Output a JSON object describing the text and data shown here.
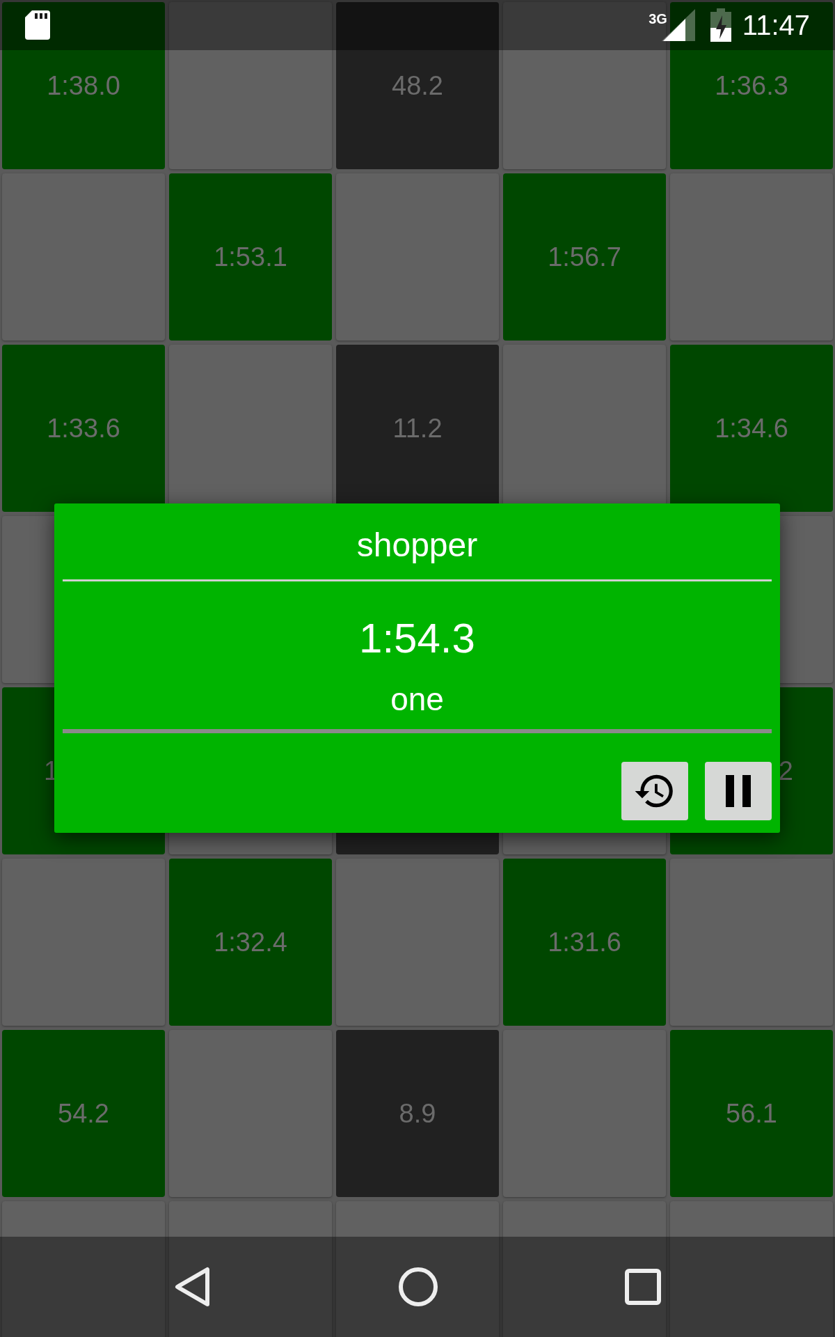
{
  "status_bar": {
    "network": "3G",
    "time": "11:47"
  },
  "grid": {
    "rows": [
      [
        {
          "kind": "green",
          "text": "1:38.0"
        },
        {
          "kind": "gray"
        },
        {
          "kind": "dark",
          "text": "48.2"
        },
        {
          "kind": "gray"
        },
        {
          "kind": "green",
          "text": "1:36.3"
        }
      ],
      [
        {
          "kind": "gray"
        },
        {
          "kind": "green",
          "text": "1:53.1"
        },
        {
          "kind": "gray"
        },
        {
          "kind": "green",
          "text": "1:56.7"
        },
        {
          "kind": "gray"
        }
      ],
      [
        {
          "kind": "green",
          "text": "1:33.6"
        },
        {
          "kind": "gray"
        },
        {
          "kind": "dark",
          "text": "11.2"
        },
        {
          "kind": "gray"
        },
        {
          "kind": "green",
          "text": "1:34.6"
        }
      ],
      [
        {
          "kind": "gray"
        },
        {
          "kind": "hidden"
        },
        {
          "kind": "hidden"
        },
        {
          "kind": "hidden"
        },
        {
          "kind": "gray"
        }
      ],
      [
        {
          "kind": "green",
          "text": "1",
          "covered_right": true
        },
        {
          "kind": "gray"
        },
        {
          "kind": "dark"
        },
        {
          "kind": "gray"
        },
        {
          "kind": "green",
          "text": "2",
          "covered_left": true
        }
      ],
      [
        {
          "kind": "gray"
        },
        {
          "kind": "green",
          "text": "1:32.4"
        },
        {
          "kind": "gray"
        },
        {
          "kind": "green",
          "text": "1:31.6"
        },
        {
          "kind": "gray"
        }
      ],
      [
        {
          "kind": "green",
          "text": "54.2"
        },
        {
          "kind": "gray"
        },
        {
          "kind": "dark",
          "text": "8.9"
        },
        {
          "kind": "gray"
        },
        {
          "kind": "green",
          "text": "56.1"
        }
      ],
      [
        {
          "kind": "gray"
        },
        {
          "kind": "gray"
        },
        {
          "kind": "gray"
        },
        {
          "kind": "gray"
        },
        {
          "kind": "gray"
        }
      ]
    ]
  },
  "dialog": {
    "title": "shopper",
    "time": "1:54.3",
    "subtitle": "one",
    "buttons": [
      {
        "kind": "history"
      },
      {
        "kind": "pause"
      }
    ]
  }
}
